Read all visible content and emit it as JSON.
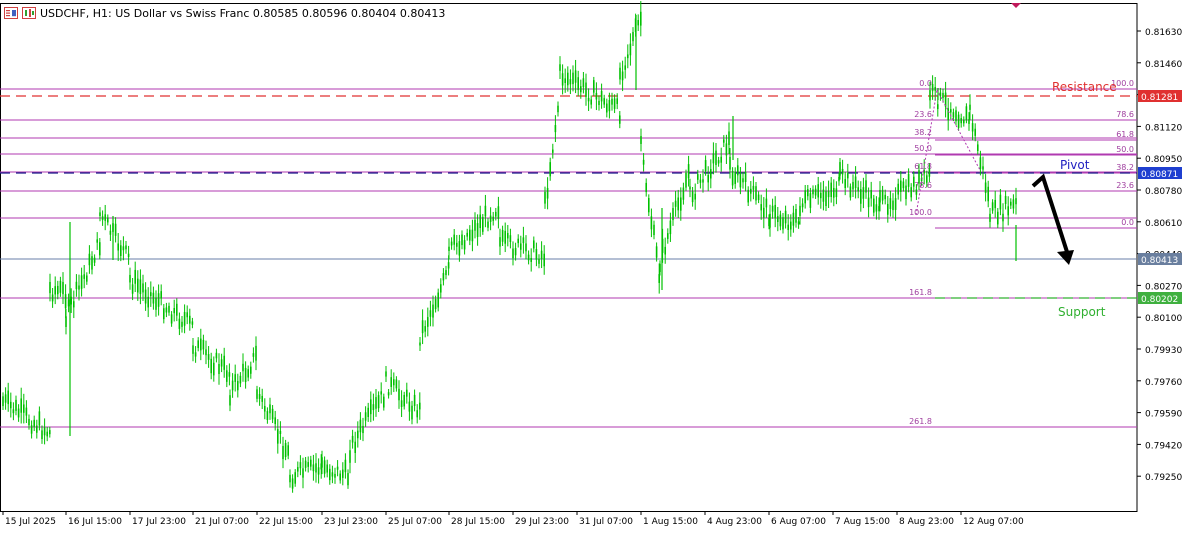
{
  "header": {
    "symbol_line": "USDCHF, H1:  US Dollar vs Swiss Franc  0.80585 0.80596 0.80404 0.80413",
    "icon_menu": "chart-menu-icon",
    "icon_objects": "objects-icon"
  },
  "colors": {
    "bull_candle": "#00c000",
    "fib_line": "#b03ab0",
    "fib_text": "#a040a0",
    "resistance": "#e03030",
    "pivot": "#2020c0",
    "support": "#30b030",
    "price_line": "#6a7fa8",
    "arrow": "#000000"
  },
  "annotations": {
    "resistance_label": "Resistance",
    "pivot_label": "Pivot",
    "support_label": "Support"
  },
  "price_axis": {
    "ticks": [
      "0.81630",
      "0.81460",
      "0.81290",
      "0.81120",
      "0.80950",
      "0.80780",
      "0.80610",
      "0.80440",
      "0.80270",
      "0.80100",
      "0.79930",
      "0.79760",
      "0.79590",
      "0.79420",
      "0.79250"
    ],
    "badges": {
      "resistance": "0.81281",
      "pivot": "0.80871",
      "current": "0.80413",
      "support": "0.80202"
    }
  },
  "time_axis": {
    "ticks": [
      "15 Jul 2025",
      "16 Jul 15:00",
      "17 Jul 23:00",
      "21 Jul 07:00",
      "22 Jul 15:00",
      "23 Jul 23:00",
      "25 Jul 07:00",
      "28 Jul 15:00",
      "29 Jul 23:00",
      "31 Jul 07:00",
      "1 Aug 15:00",
      "4 Aug 23:00",
      "6 Aug 07:00",
      "7 Aug 15:00",
      "8 Aug 23:00",
      "12 Aug 07:00"
    ]
  },
  "fib_left": {
    "levels": [
      "0.0",
      "23.6",
      "38.2",
      "50.0",
      "61.8",
      "78.6",
      "100.0",
      "161.8",
      "261.8"
    ]
  },
  "fib_right": {
    "levels": [
      "100.0",
      "78.6",
      "61.8",
      "50.0",
      "38.2",
      "23.6",
      "0.0"
    ]
  },
  "chart_data": {
    "type": "candlestick",
    "symbol": "USDCHF",
    "timeframe": "H1",
    "ohlc_last": {
      "open": 0.80585,
      "high": 0.80596,
      "low": 0.80404,
      "close": 0.80413
    },
    "ylim": [
      0.7916,
      0.8178
    ],
    "key_levels": {
      "resistance": 0.81281,
      "pivot": 0.80871,
      "support": 0.80202,
      "current": 0.80413
    },
    "fib_left_prices": [
      0.813,
      0.8114,
      0.81045,
      0.80965,
      0.80885,
      0.8077,
      0.8063,
      0.80225,
      0.79545
    ],
    "fib_right_prices": [
      0.813,
      0.8115,
      0.81045,
      0.80965,
      0.80885,
      0.80755,
      0.8059
    ],
    "close_path": [
      [
        0.7965,
        0.7948
      ],
      [
        0.8025,
        0.8023
      ],
      [
        0.801,
        0.805
      ],
      [
        0.8065,
        0.804
      ],
      [
        0.803,
        0.8005
      ],
      [
        0.7995,
        0.798
      ],
      [
        0.797,
        0.799
      ],
      [
        0.797,
        0.7935
      ],
      [
        0.7925,
        0.793
      ],
      [
        0.793,
        0.7925
      ],
      [
        0.794,
        0.797
      ],
      [
        0.7975,
        0.796
      ],
      [
        0.8,
        0.8035
      ],
      [
        0.8045,
        0.807
      ],
      [
        0.805,
        0.8043
      ],
      [
        0.807,
        0.813
      ],
      [
        0.814,
        0.812
      ],
      [
        0.814,
        0.817
      ],
      [
        0.81,
        0.803
      ],
      [
        0.804,
        0.809
      ],
      [
        0.8075,
        0.8105
      ],
      [
        0.809,
        0.8065
      ],
      [
        0.8065,
        0.806
      ],
      [
        0.807,
        0.808
      ],
      [
        0.8085,
        0.807
      ],
      [
        0.807,
        0.8085
      ],
      [
        0.813,
        0.8115
      ],
      [
        0.812,
        0.807
      ],
      [
        0.8065,
        0.807
      ],
      [
        0.807,
        0.80413
      ]
    ]
  }
}
